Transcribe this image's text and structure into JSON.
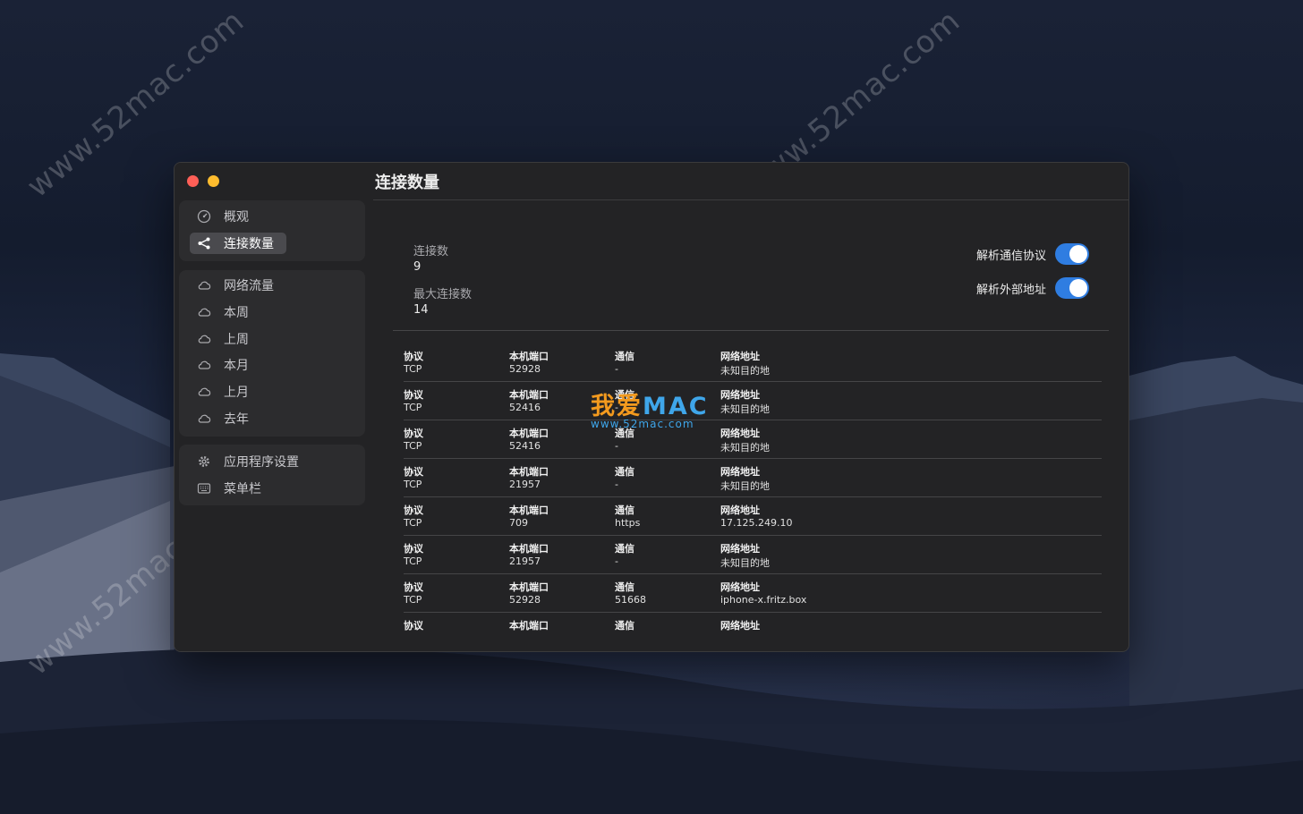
{
  "window": {
    "title": "连接数量",
    "traffic_lights": {
      "close_color": "#fe5f57",
      "minimize_color": "#febc2e"
    }
  },
  "sidebar": {
    "group1": [
      {
        "label": "概观",
        "icon": "gauge-icon",
        "active": false
      },
      {
        "label": "连接数量",
        "icon": "share-icon",
        "active": true
      }
    ],
    "group2": [
      {
        "label": "网络流量",
        "icon": "cloud-icon"
      },
      {
        "label": "本周",
        "icon": "cloud-icon"
      },
      {
        "label": "上周",
        "icon": "cloud-icon"
      },
      {
        "label": "本月",
        "icon": "cloud-icon"
      },
      {
        "label": "上月",
        "icon": "cloud-icon"
      },
      {
        "label": "去年",
        "icon": "cloud-icon"
      }
    ],
    "group3": [
      {
        "label": "应用程序设置",
        "icon": "gear-icon"
      },
      {
        "label": "菜单栏",
        "icon": "keyboard-icon"
      }
    ]
  },
  "stats": {
    "connections_label": "连接数",
    "connections_value": "9",
    "max_connections_label": "最大连接数",
    "max_connections_value": "14"
  },
  "toggles": {
    "resolve_protocol_label": "解析通信协议",
    "resolve_protocol_on": true,
    "resolve_address_label": "解析外部地址",
    "resolve_address_on": true,
    "accent_color": "#2f7de1"
  },
  "table": {
    "headers": {
      "protocol": "协议",
      "local_port": "本机端口",
      "service": "通信",
      "address": "网络地址"
    },
    "rows": [
      {
        "protocol": "TCP",
        "local_port": "52928",
        "service": "-",
        "address": "未知目的地"
      },
      {
        "protocol": "TCP",
        "local_port": "52416",
        "service": "-",
        "address": "未知目的地"
      },
      {
        "protocol": "TCP",
        "local_port": "52416",
        "service": "-",
        "address": "未知目的地"
      },
      {
        "protocol": "TCP",
        "local_port": "21957",
        "service": "-",
        "address": "未知目的地"
      },
      {
        "protocol": "TCP",
        "local_port": "709",
        "service": "https",
        "address": "17.125.249.10"
      },
      {
        "protocol": "TCP",
        "local_port": "21957",
        "service": "-",
        "address": "未知目的地"
      },
      {
        "protocol": "TCP",
        "local_port": "52928",
        "service": "51668",
        "address": "iphone-x.fritz.box"
      },
      {
        "protocol": "",
        "local_port": "",
        "service": "",
        "address": ""
      }
    ]
  },
  "watermarks": {
    "site": "www.52mac.com",
    "logo_cn": "我爱",
    "logo_en": "MAC",
    "logo_url": "www.52mac.com"
  }
}
